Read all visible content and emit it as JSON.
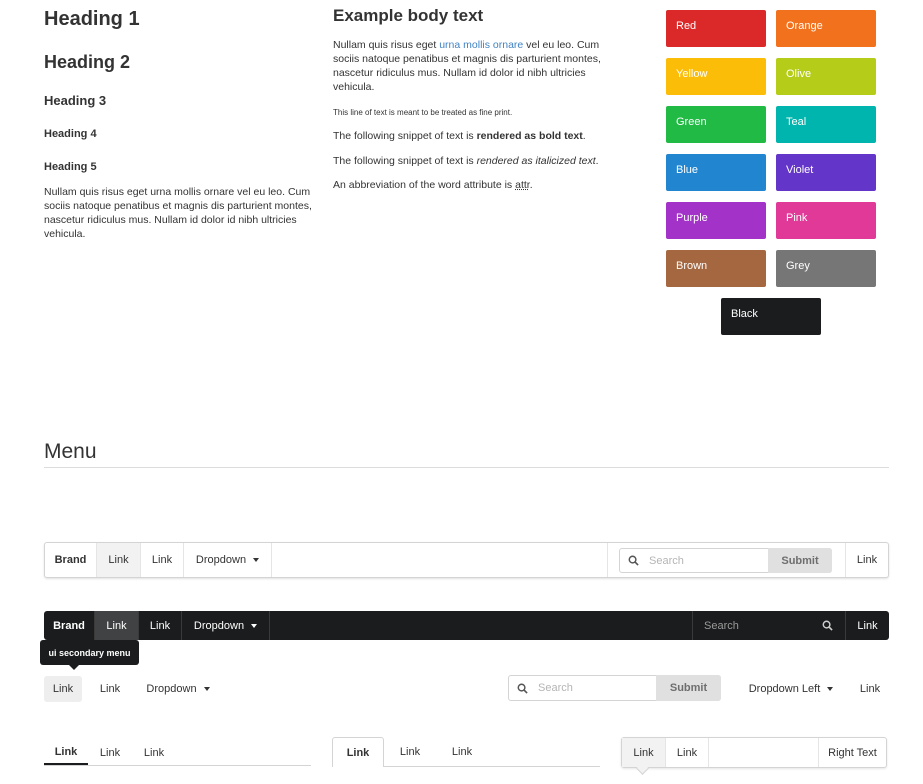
{
  "typography": {
    "h1": "Heading 1",
    "h2": "Heading 2",
    "h3": "Heading 3",
    "h4": "Heading 4",
    "h5": "Heading 5",
    "paragraph": "Nullam quis risus eget urna mollis ornare vel eu leo. Cum sociis natoque penatibus et magnis dis parturient montes, nascetur ridiculus mus. Nullam id dolor id nibh ultricies vehicula.",
    "body_title": "Example body text",
    "body_pre": "Nullam quis risus eget ",
    "body_link": "urna mollis ornare",
    "body_post": " vel eu leo. Cum sociis natoque penatibus et magnis dis parturient montes, nascetur ridiculus mus. Nullam id dolor id nibh ultricies vehicula.",
    "fine_print": "This line of text is meant to be treated as fine print.",
    "bold_pre": "The following snippet of text is ",
    "bold_text": "rendered as bold text",
    "bold_post": ".",
    "italic_pre": "The following snippet of text is ",
    "italic_text": "rendered as italicized text",
    "italic_post": ".",
    "abbr_pre": "An abbreviation of the word attribute is ",
    "abbr_text": "attr",
    "abbr_post": "."
  },
  "colors": [
    {
      "label": "Red",
      "hex": "#db2828"
    },
    {
      "label": "Orange",
      "hex": "#f2711c"
    },
    {
      "label": "Yellow",
      "hex": "#fbbd08"
    },
    {
      "label": "Olive",
      "hex": "#b5cc18"
    },
    {
      "label": "Green",
      "hex": "#21ba45"
    },
    {
      "label": "Teal",
      "hex": "#00b5ad"
    },
    {
      "label": "Blue",
      "hex": "#2185d0"
    },
    {
      "label": "Violet",
      "hex": "#6435c9"
    },
    {
      "label": "Purple",
      "hex": "#a333c8"
    },
    {
      "label": "Pink",
      "hex": "#e03997"
    },
    {
      "label": "Brown",
      "hex": "#a5673f"
    },
    {
      "label": "Grey",
      "hex": "#767676"
    },
    {
      "label": "Black",
      "hex": "#1b1c1d"
    }
  ],
  "menu_section": {
    "title": "Menu"
  },
  "menu1": {
    "brand": "Brand",
    "link1": "Link",
    "link2": "Link",
    "dropdown": "Dropdown",
    "search_placeholder": "Search",
    "submit": "Submit",
    "right_link": "Link"
  },
  "menu2": {
    "brand": "Brand",
    "link1": "Link",
    "link2": "Link",
    "dropdown": "Dropdown",
    "search_placeholder": "Search",
    "right_link": "Link"
  },
  "tooltip": "ui secondary menu",
  "secondary": {
    "link1": "Link",
    "link2": "Link",
    "dropdown": "Dropdown",
    "search_placeholder": "Search",
    "submit": "Submit",
    "dropdown_left": "Dropdown Left",
    "right_link": "Link"
  },
  "pointing": {
    "link1": "Link",
    "link2": "Link",
    "link3": "Link"
  },
  "tabular": {
    "link1": "Link",
    "link2": "Link",
    "link3": "Link"
  },
  "pointing_box": {
    "link1": "Link",
    "link2": "Link",
    "right_text": "Right Text"
  }
}
